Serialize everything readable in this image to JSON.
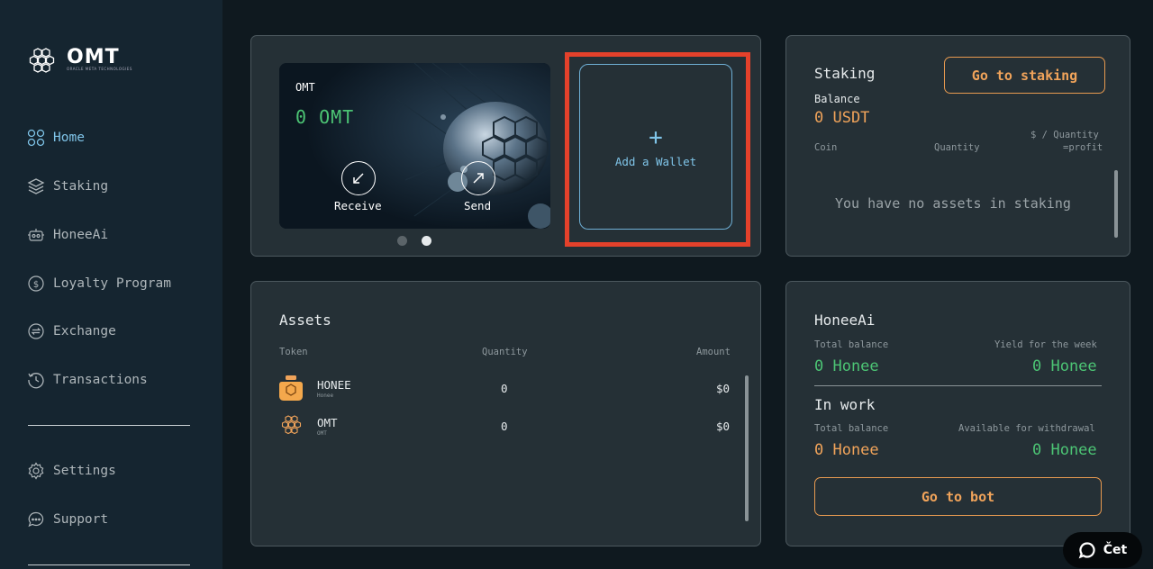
{
  "logo": {
    "text": "OMT",
    "subtitle": "ORACLE META TECHNOLOGIES"
  },
  "sidebar": {
    "items": [
      {
        "label": "Home",
        "icon": "home-grid-icon",
        "active": true
      },
      {
        "label": "Staking",
        "icon": "layers-icon"
      },
      {
        "label": "HoneeAi",
        "icon": "robot-icon"
      },
      {
        "label": "Loyalty Program",
        "icon": "dollar-coin-icon"
      },
      {
        "label": "Exchange",
        "icon": "exchange-icon"
      },
      {
        "label": "Transactions",
        "icon": "history-icon"
      }
    ],
    "bottom_items": [
      {
        "label": "Settings",
        "icon": "gear-icon"
      },
      {
        "label": "Support",
        "icon": "chat-bubble-icon"
      }
    ]
  },
  "wallet": {
    "card_title": "OMT",
    "balance": "0 OMT",
    "receive_label": "Receive",
    "send_label": "Send",
    "carousel_active_index": 1,
    "add_wallet_label": "Add a Wallet",
    "add_wallet_icon": "+"
  },
  "staking": {
    "title": "Staking",
    "go_button": "Go to staking",
    "balance_label": "Balance",
    "balance_value": "0 USDT",
    "col_coin": "Coin",
    "col_quantity": "Quantity",
    "col_profit_1": "$ / Quantity",
    "col_profit_2": "=profit",
    "empty_text": "You have no assets in staking"
  },
  "assets": {
    "title": "Assets",
    "columns": [
      "Token",
      "Quantity",
      "Amount"
    ],
    "rows": [
      {
        "name": "HONEE",
        "sub": "Honee",
        "quantity": "0",
        "amount": "$0",
        "icon": "honee-jar-icon"
      },
      {
        "name": "OMT",
        "sub": "OMT",
        "quantity": "0",
        "amount": "$0",
        "icon": "omt-hex-icon"
      }
    ]
  },
  "honeeai": {
    "title": "HoneeAi",
    "total_balance_label": "Total balance",
    "total_balance": "0 Honee",
    "yield_label": "Yield for the week",
    "yield_value": "0 Honee",
    "in_work_title": "In work",
    "work_total_label": "Total balance",
    "work_total": "0 Honee",
    "withdraw_label": "Available for withdrawal",
    "withdraw_value": "0 Honee",
    "bot_button": "Go to bot"
  },
  "chat": {
    "label": "Čet"
  },
  "colors": {
    "accent_blue": "#7fc4e8",
    "orange": "#f0a35a",
    "green": "#4cc474",
    "highlight_red": "#e4412b"
  }
}
